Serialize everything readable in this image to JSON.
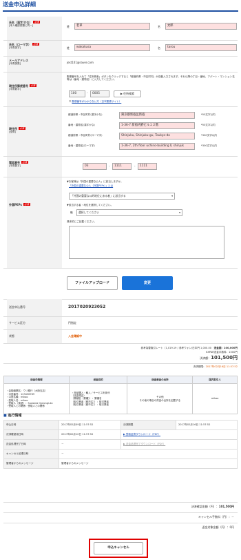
{
  "page_title": "送金申込詳細",
  "name_kanji": {
    "label": "氏名（漢字/かな）",
    "sub": "[本人確認書類と同一]",
    "req": "必須",
    "sei_lbl": "姓",
    "sei": "若草",
    "mei_lbl": "名",
    "mei": "太郎"
  },
  "name_roman": {
    "label": "氏名（ローマ字）",
    "sub": "[半角英字]",
    "req": "必須",
    "sei_lbl": "姓",
    "sei": "wakakusa",
    "mei_lbl": "名",
    "mei": "tarou"
  },
  "email": {
    "label": "メールアドレス",
    "sub": "[半角英数]",
    "value": "jest101@raver.com"
  },
  "postal": {
    "label": "現住所郵便番号",
    "sub": "[半角数字]",
    "req": "必須",
    "instr": "郵便番号を入れて「住所検索」ボタンをクリックすると「都道府県・市区町村」が自動入力されます。それ以降の丁目・番地、アパート・マンション名等は（番地・建物名）に入力してください。",
    "p1": "100",
    "p2": "0005",
    "search_btn": "住所検索",
    "link": "郵便番号がわからない方（日本郵便サイト）"
  },
  "address": {
    "label": "現住所",
    "sub": "[全角]",
    "req": "必須",
    "rows": [
      {
        "label": "都道府県・市区町村(漢字かな)",
        "value": "東京都新宿区新宿",
        "note": "*50文字以内"
      },
      {
        "label": "番地・建物名(漢字かな)",
        "value": "1-36-7 新宿内野ビル１２階",
        "note": "*50文字以内"
      },
      {
        "label": "都道府県・市区町村(ローマ字)",
        "value": "Shinjuku, Shinjuku-gu, Toukyo-do",
        "note": "*300文字以内"
      },
      {
        "label": "番地・建物名(ローマ字)",
        "value": "1-36-7, 2th floor uchino-building Ⅱ, shinjuk",
        "note": "*300文字以内"
      }
    ]
  },
  "phone": {
    "label": "電話番号",
    "sub": "[半角数字]",
    "req": "必須",
    "p1": "03",
    "p2": "1111",
    "p3": "1111"
  },
  "peps": {
    "label": "外国PEPs",
    "req": "必須",
    "q1": "▼お客様は「外国の重要な公人」に該当しますか。",
    "q1_link": "「外国の重要な公人（外国PEPs）」とは",
    "select1": "「外国の重要な公的地位にある者」に該当する",
    "q2": "▼該当する者・地位を選択してください。",
    "select2_lbl": "職",
    "select2": "選択してください",
    "q3": "具体的にご記載ください。"
  },
  "buttons": {
    "upload": "ファイルアップロード",
    "change": "変更",
    "cancel": "申込キャンセル"
  },
  "info": {
    "rows": [
      {
        "label": "送金申込番号",
        "value": "2017020923052"
      },
      {
        "label": "サービス区分",
        "value": "円指定"
      },
      {
        "label": "状態",
        "value": "入金確認中"
      }
    ]
  },
  "rate": {
    "line1a": "参考為替取引レート（1,019.19 / 参考ウォン/日本円 1,000.00",
    "line1b": "送金額：100,000円",
    "line2": "EXPAR送金手数料：1500円",
    "line3_lbl": "決済額：",
    "line3_val": "101,500円",
    "deadline_lbl": "決済期限：",
    "deadline_val": "2017年02月16日 11:57:52"
  },
  "recv": {
    "headers": [
      "送金先情報",
      "送金目的",
      "送金資金の出所",
      "国内取引人"
    ],
    "info": [
      "・金融機関名：ウリ銀行（大阪支店）",
      "・口座番号：123456789",
      "・口座名義：mikoo",
      "・受取人名：mikoo",
      "・受取人（英語）：Suwonia Gyeongi-do",
      "・受取人との関係：受取人との関係"
    ],
    "purpose": [
      "・商品購入・輸入／サービス利用代",
      "（送金理由）",
      "（業種名（業種））：業種名",
      "（取引業者（都市名））：取引業者",
      "（取引業者（都市名））：取引業者"
    ],
    "source": "その他",
    "source2": "その他の場合の資金の出所を記載する",
    "counter": "mikoo"
  },
  "progress": {
    "title": "進行情報",
    "rows": [
      {
        "k1": "申込日時",
        "v1": "2017年02月09日 11:57:52",
        "k2": "決済期限",
        "v2": "2017年02月16日 11:57:52"
      },
      {
        "k1": "決済確認用日時",
        "v1": "2017年02月10日 11:57:52",
        "k2": "",
        "v2": "▶ 受取証書ダウンロード（PDF）"
      },
      {
        "k1": "送金処理完了日時",
        "v1": "－",
        "k2": "",
        "v2": "▶ 送金処理完了ダウンロード（PDF）"
      },
      {
        "k1": "キャンセル処理日時",
        "v1": "－",
        "k2": "",
        "v2": ""
      },
      {
        "k1": "管理者からのメッセージ",
        "v1": "管理者からのメッセージ",
        "k2": "",
        "v2": ""
      }
    ]
  },
  "totals": [
    {
      "label": "決済確認金額（円）：",
      "value": "101,500円"
    },
    {
      "label": "キャンセル手数料（円）：",
      "value": "－"
    },
    {
      "label": "返金対象金額（円）：",
      "value": "0円"
    }
  ],
  "colors": {
    "title": "#1e50a2",
    "required": "#e00000",
    "accent": "#1a73d9",
    "status": "#e05a00",
    "field_pink": "#fde0e0"
  }
}
